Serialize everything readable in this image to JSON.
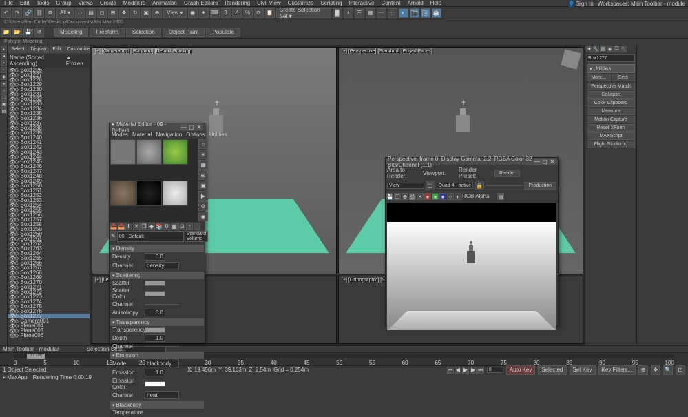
{
  "topmenu": [
    "File",
    "Edit",
    "Tools",
    "Group",
    "Views",
    "Create",
    "Modifiers",
    "Animation",
    "Graph Editors",
    "Rendering",
    "Civil View",
    "Customize",
    "Scripting",
    "Interactive",
    "Content",
    "Arnold",
    "Help"
  ],
  "signin": {
    "label": "Sign In",
    "workspaces": "Workspaces: Main Toolbar - module"
  },
  "pathbar": "C:\\Users\\Ben Cutler\\Desktop\\Documents\\3ds Max 2020",
  "ribbon": {
    "tabs": [
      "Modeling",
      "Freeform",
      "Selection",
      "Object Paint",
      "Populate"
    ],
    "sub": "Polygon Modeling"
  },
  "scene": {
    "tabs": [
      "Select",
      "Display",
      "Edit",
      "Customize"
    ],
    "header": {
      "name": "Name (Sorted Ascending)",
      "frozen": "▲ Frozen"
    },
    "items": [
      "Box1226",
      "Box1227",
      "Box1228",
      "Box1229",
      "Box1230",
      "Box1231",
      "Box1232",
      "Box1233",
      "Box1234",
      "Box1235",
      "Box1236",
      "Box1237",
      "Box1238",
      "Box1239",
      "Box1240",
      "Box1241",
      "Box1242",
      "Box1243",
      "Box1244",
      "Box1245",
      "Box1246",
      "Box1247",
      "Box1248",
      "Box1249",
      "Box1250",
      "Box1251",
      "Box1252",
      "Box1253",
      "Box1254",
      "Box1255",
      "Box1256",
      "Box1257",
      "Box1258",
      "Box1259",
      "Box1260",
      "Box1261",
      "Box1262",
      "Box1263",
      "Box1264",
      "Box1265",
      "Box1266",
      "Box1267",
      "Box1268",
      "Box1269",
      "Box1270",
      "Box1271",
      "Box1272",
      "Box1273",
      "Box1274",
      "Box1275",
      "Box1276",
      "Box1277",
      "Camera001",
      "Plane004",
      "Plane005",
      "Plane006"
    ],
    "selected": "Box1277"
  },
  "viewports": {
    "v1": "[+] [Camera001] [Standard] [Default Shading]",
    "v2": "[+] [Perspective] [Standard] [Edged Faces]",
    "v3": "[+] [Left] [Standard]",
    "v4": "[+] [Orthographic] [Standard] [Edged Faces]"
  },
  "rightpanel": {
    "object": "Box1277",
    "section": "Utilities",
    "btns": {
      "more": "More...",
      "sets": "Sets"
    },
    "utils": [
      "Perspective Match",
      "Collapse",
      "Color Clipboard",
      "Measure",
      "Motion Capture",
      "Reset XForm",
      "MAXScript",
      "Flight Studio (c)"
    ]
  },
  "statusbar": "Main Toolbar - modular",
  "statusbar2": {
    "sel": "Selection Sets:"
  },
  "timeline": {
    "frame": "0 / 100",
    "ticks": [
      "0",
      "5",
      "10",
      "15",
      "20",
      "25",
      "30",
      "35",
      "40",
      "45",
      "50",
      "55",
      "60",
      "65",
      "70",
      "75",
      "80",
      "85",
      "90",
      "95",
      "100"
    ]
  },
  "bottombar": {
    "selinfo": "1 Object Selected",
    "coords": {
      "x": "X: 19.456m",
      "y": "Y: 39.163m",
      "z": "Z: 2.54m"
    },
    "grid": "Grid = 0.254m",
    "autokey": "Auto Key",
    "setkey": "Set Key",
    "selected": "Selected",
    "keyfilters": "Key Filters..."
  },
  "status3": {
    "script": "MaxApp",
    "render": "Rendering Time 0:00:19"
  },
  "material_editor": {
    "title": "● Material Editor - 09 - Default",
    "menu": [
      "Modes",
      "Material",
      "Navigation",
      "Options",
      "Utilities"
    ],
    "name_field": "09 - Default",
    "shader": "Standard Volume",
    "sections": {
      "density": {
        "h": "Density",
        "density": "Density",
        "density_v": "0.0",
        "channel": "Channel",
        "channel_v": "density"
      },
      "scattering": {
        "h": "Scattering",
        "scatter": "Scatter",
        "scolor": "Scatter Color",
        "channel": "Channel",
        "aniso": "Anisotropy",
        "aniso_v": "0.0"
      },
      "transparency": {
        "h": "Transparency",
        "trans": "Transparency",
        "depth": "Depth",
        "depth_v": "1.0",
        "channel": "Channel"
      },
      "emission": {
        "h": "Emission",
        "mode": "Mode",
        "mode_v": "blackbody",
        "emission": "Emission",
        "emission_v": "1.0",
        "ecolor": "Emission Color",
        "channel": "Channel",
        "channel_v": "heat"
      },
      "blackbody": {
        "h": "Blackbody",
        "temp": "Temperature"
      }
    }
  },
  "render_window": {
    "title": "Perspective, frame 0, Display Gamma: 2.2, RGBA Color 32 Bits/Channel (1:1)",
    "area": "Area to Render:",
    "area_v": "View",
    "viewport": "Viewport:",
    "viewport_v": "Quad 4 - active",
    "preset": "Render Preset:",
    "preset_v": "",
    "render_btn": "Render",
    "prod_btn": "Production",
    "alpha": "RGB Alpha"
  }
}
